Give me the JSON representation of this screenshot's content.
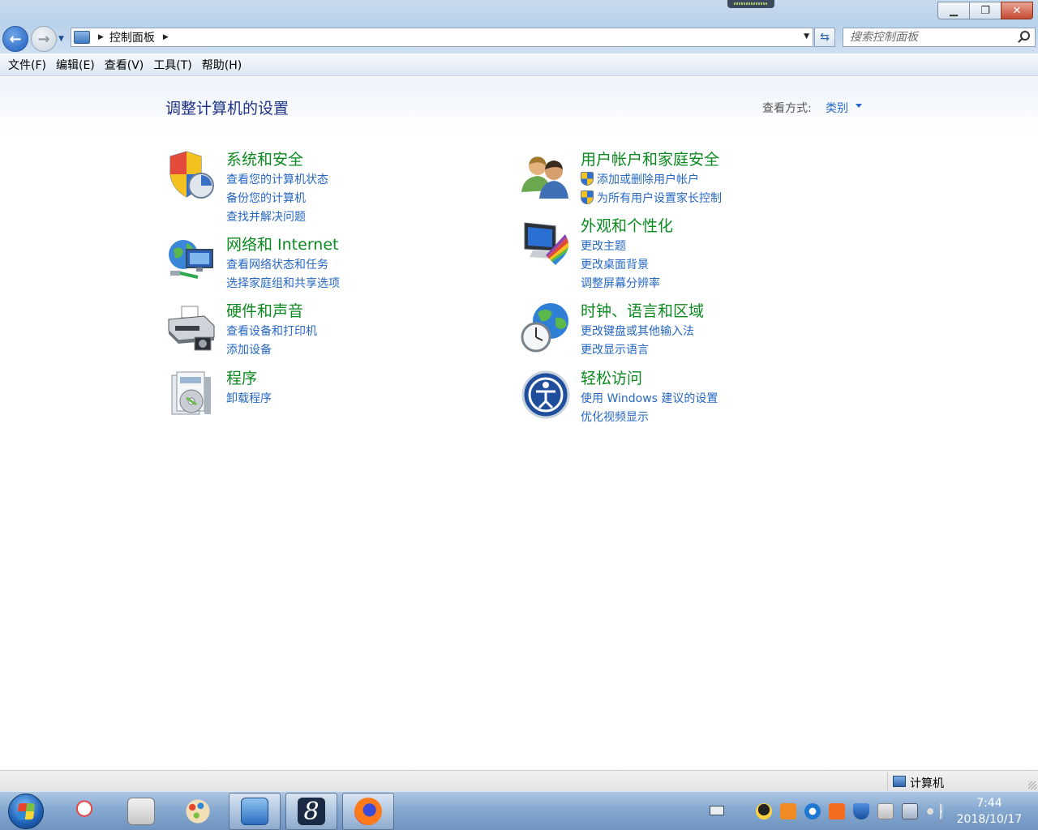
{
  "window": {
    "minimize": "▁",
    "maximize": "❐",
    "close": "✕"
  },
  "navigation": {
    "back_glyph": "←",
    "forward_glyph": "→",
    "address": {
      "crumbs": [
        "控制面板"
      ]
    },
    "search_placeholder": "搜索控制面板"
  },
  "menu": [
    "文件(F)",
    "编辑(E)",
    "查看(V)",
    "工具(T)",
    "帮助(H)"
  ],
  "header": {
    "title": "调整计算机的设置",
    "view_by_label": "查看方式:",
    "view_by_value": "类别"
  },
  "categories": [
    {
      "title": "系统和安全",
      "icon": "shield-security-icon",
      "links": [
        {
          "label": "查看您的计算机状态",
          "shield": false
        },
        {
          "label": "备份您的计算机",
          "shield": false
        },
        {
          "label": "查找并解决问题",
          "shield": false
        }
      ]
    },
    {
      "title": "网络和 Internet",
      "icon": "network-globe-icon",
      "links": [
        {
          "label": "查看网络状态和任务",
          "shield": false
        },
        {
          "label": "选择家庭组和共享选项",
          "shield": false
        }
      ]
    },
    {
      "title": "硬件和声音",
      "icon": "printer-icon",
      "links": [
        {
          "label": "查看设备和打印机",
          "shield": false
        },
        {
          "label": "添加设备",
          "shield": false
        }
      ]
    },
    {
      "title": "程序",
      "icon": "programs-disc-icon",
      "links": [
        {
          "label": "卸载程序",
          "shield": false
        }
      ]
    },
    {
      "title": "用户帐户和家庭安全",
      "icon": "users-icon",
      "links": [
        {
          "label": "添加或删除用户帐户",
          "shield": true
        },
        {
          "label": "为所有用户设置家长控制",
          "shield": true
        }
      ]
    },
    {
      "title": "外观和个性化",
      "icon": "monitor-palette-icon",
      "links": [
        {
          "label": "更改主题",
          "shield": false
        },
        {
          "label": "更改桌面背景",
          "shield": false
        },
        {
          "label": "调整屏幕分辨率",
          "shield": false
        }
      ]
    },
    {
      "title": "时钟、语言和区域",
      "icon": "clock-globe-icon",
      "links": [
        {
          "label": "更改键盘或其他输入法",
          "shield": false
        },
        {
          "label": "更改显示语言",
          "shield": false
        }
      ]
    },
    {
      "title": "轻松访问",
      "icon": "ease-of-access-icon",
      "links": [
        {
          "label": "使用 Windows 建议的设置",
          "shield": false
        },
        {
          "label": "优化视频显示",
          "shield": false
        }
      ]
    }
  ],
  "status": {
    "location": "计算机"
  },
  "taskbar": {
    "apps": [
      "snipping-tool-icon",
      "calculator-icon",
      "paint-icon",
      "control-panel-icon",
      "app-8-icon",
      "firefox-icon"
    ],
    "app8_glyph": "8",
    "time": "7:44",
    "date": "2018/10/17"
  }
}
